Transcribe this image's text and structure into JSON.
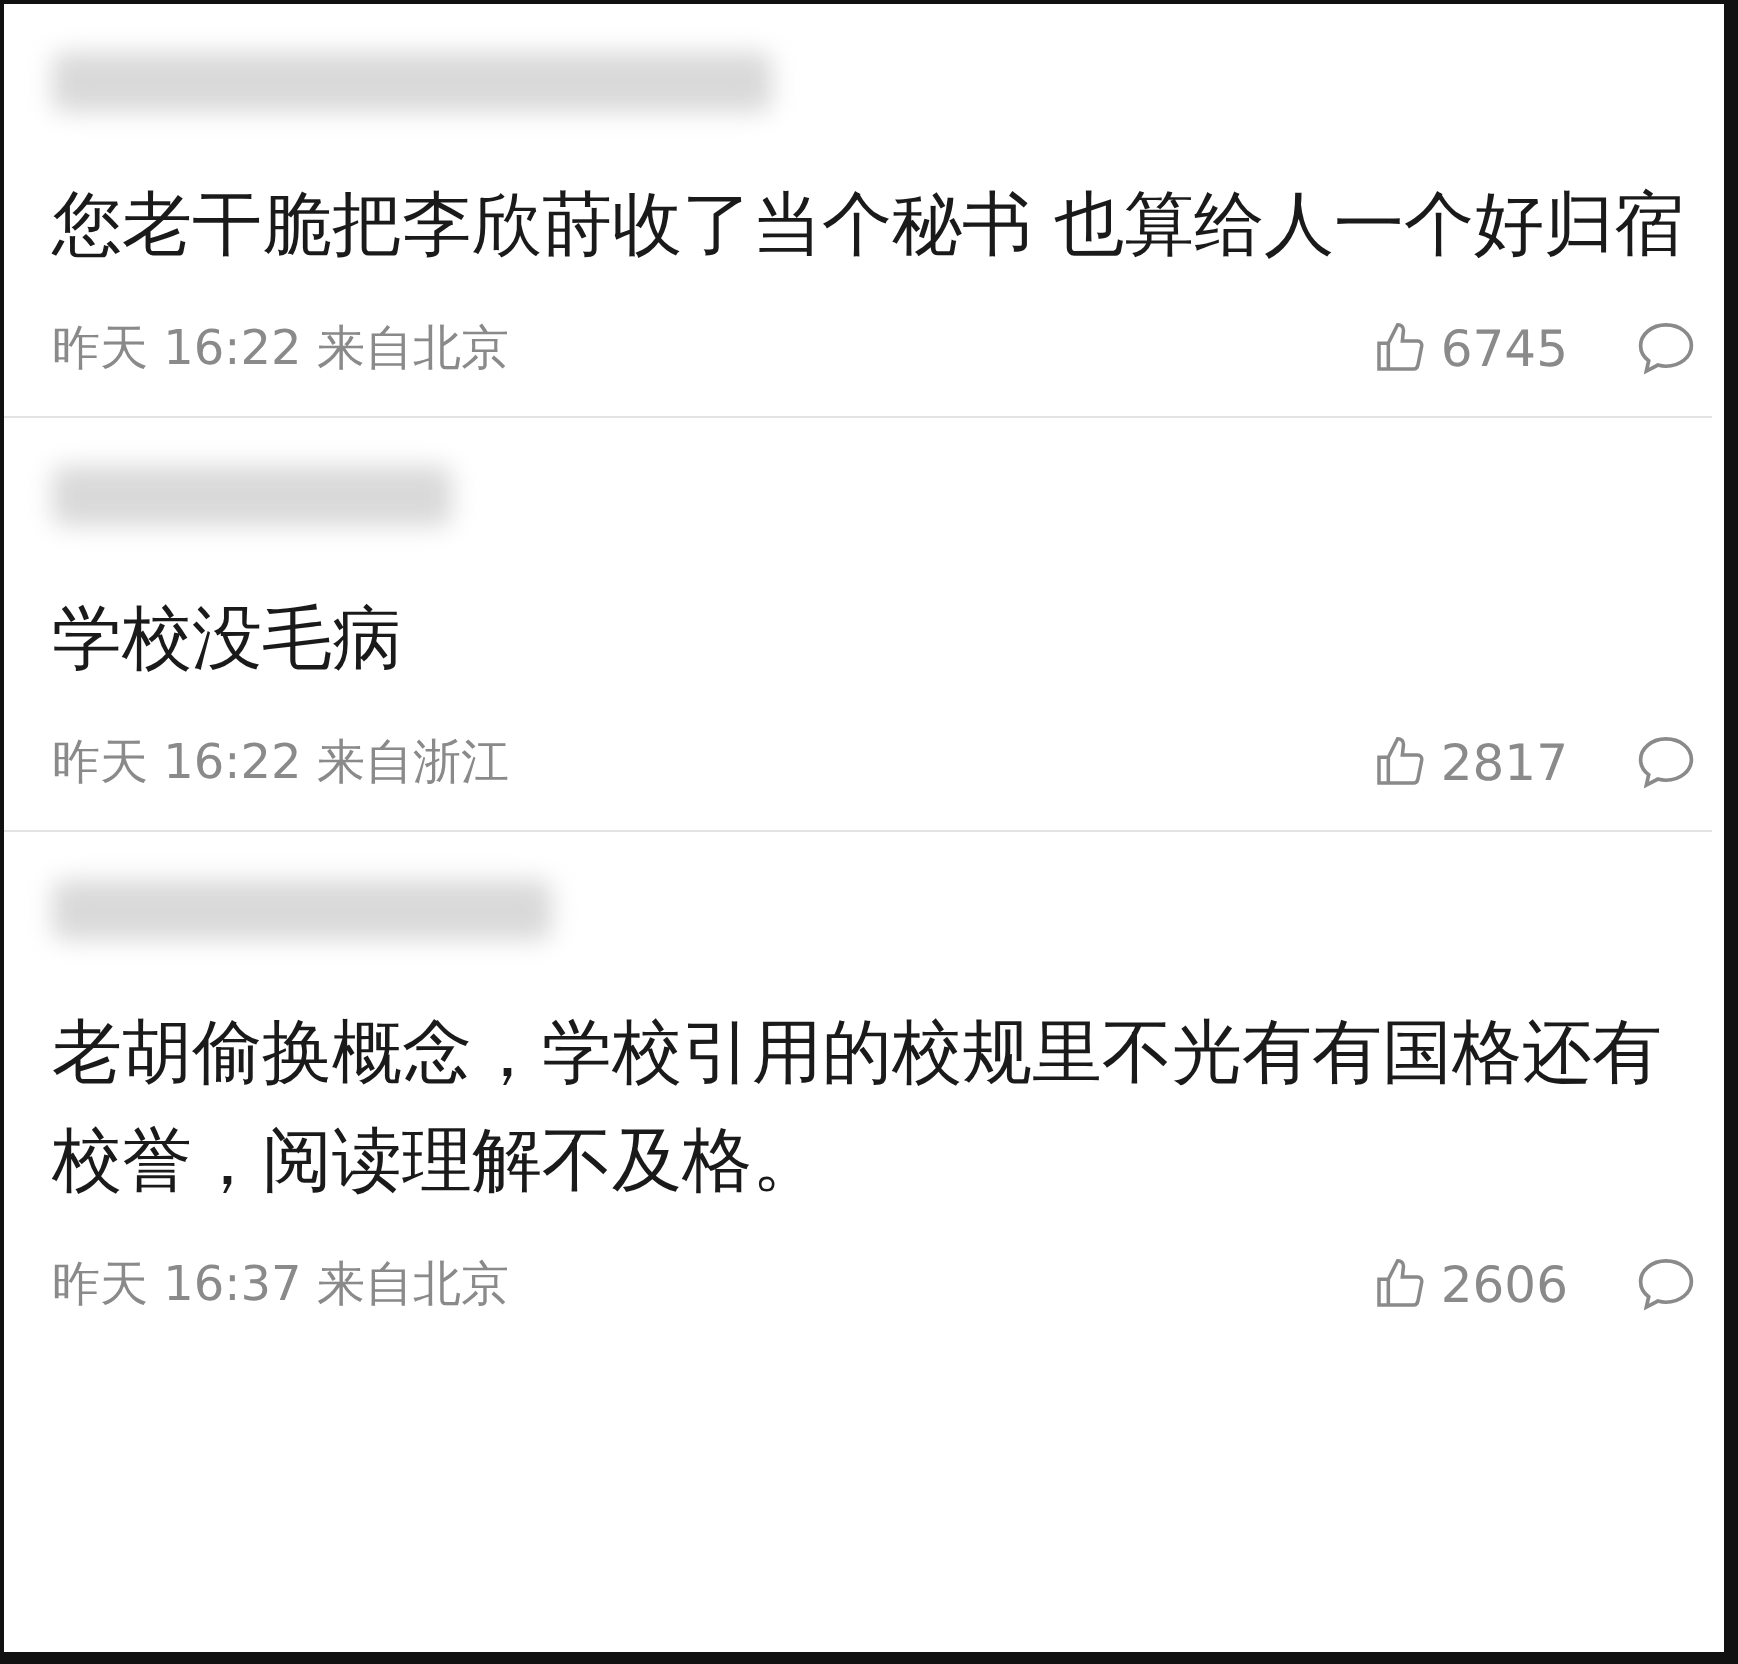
{
  "comments": [
    {
      "text": "您老干脆把李欣莳收了当个秘书 也算给人一个好归宿",
      "time": "昨天 16:22 来自北京",
      "likes": "6745"
    },
    {
      "text": "学校没毛病",
      "time": "昨天 16:22 来自浙江",
      "likes": "2817"
    },
    {
      "text": "老胡偷换概念，学校引用的校规里不光有有国格还有校誉，阅读理解不及格。",
      "time": "昨天 16:37 来自北京",
      "likes": "2606"
    }
  ]
}
